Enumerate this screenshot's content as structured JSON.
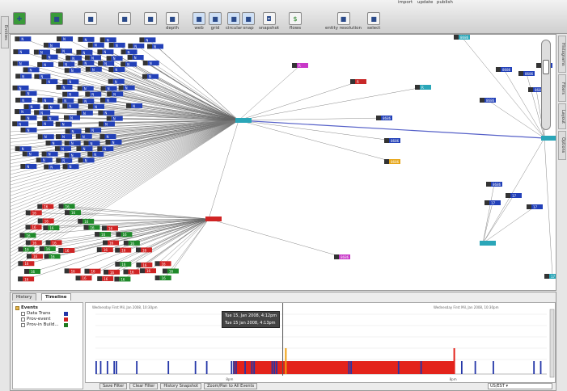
{
  "toolbar": {
    "top_buttons": [
      "import",
      "update",
      "publish"
    ],
    "tools": [
      {
        "label": "",
        "icon": "add-node-icon"
      },
      {
        "label": "",
        "icon": "pencil-icon"
      },
      {
        "label": "",
        "icon": "magnify-icon"
      },
      {
        "label": "",
        "icon": "connect-icon"
      },
      {
        "label": "",
        "icon": "group-icon"
      },
      {
        "label": "depth",
        "icon": "depth-icon"
      },
      {
        "label": "web",
        "icon": "layout-web-icon"
      },
      {
        "label": "grid",
        "icon": "layout-grid-icon"
      },
      {
        "label": "circular",
        "icon": "layout-circular-icon"
      },
      {
        "label": "snap",
        "icon": "layout-snap-icon"
      },
      {
        "label": "snapshot",
        "icon": "camera-icon"
      },
      {
        "label": "flows",
        "icon": "dollar-flows-icon"
      },
      {
        "label": "entity resolution",
        "icon": "entity-resolution-icon"
      },
      {
        "label": "select",
        "icon": "select-icon"
      }
    ]
  },
  "side_tabs": {
    "left": "Entities",
    "right": [
      "Histograms",
      "Filters",
      "Layout",
      "Options"
    ]
  },
  "graph": {
    "blue_node_label": "N",
    "red_node_label": "16",
    "green_node_label": "16",
    "hub_label": "",
    "node_labels": [
      "R",
      "R",
      "R",
      "8686",
      "8686",
      "8686",
      "8686",
      "8686",
      "8686",
      "8686",
      "8686",
      "8686",
      "8686",
      "8686",
      "17"
    ]
  },
  "bottom_tabs": [
    "History",
    "Timeline"
  ],
  "events_tree": {
    "root": "Events",
    "items": [
      {
        "label": "Data Trans",
        "color": "#2436a8"
      },
      {
        "label": "Prov-event",
        "color": "#cc2222"
      },
      {
        "label": "Prov-in Build...",
        "color": "#1f7a1f"
      }
    ]
  },
  "timeline": {
    "header_left": "Wednesday First Mil, Jan 2008, 10:30pm",
    "header_right": "Wednesday First Mil, Jan 2008, 10:30pm",
    "tooltips": [
      "Tue 15, Jan 2008, 4:12pm",
      "Tue 15 Jan 2008, 4:13pm"
    ],
    "day_labels": [
      "8pm",
      "8pm"
    ],
    "events": [
      {
        "t": 0.0,
        "color": "#2436a8"
      },
      {
        "t": 0.01,
        "color": "#2436a8"
      },
      {
        "t": 0.025,
        "color": "#2436a8"
      },
      {
        "t": 0.04,
        "color": "#2436a8"
      },
      {
        "t": 0.045,
        "color": "#2436a8"
      },
      {
        "t": 0.09,
        "color": "#2436a8"
      },
      {
        "t": 0.16,
        "color": "#2436a8"
      },
      {
        "t": 0.22,
        "color": "#2436a8"
      },
      {
        "t": 0.245,
        "color": "#2436a8"
      },
      {
        "t": 0.3,
        "color": "#2436a8"
      },
      {
        "t": 0.305,
        "color": "#2436a8"
      },
      {
        "t": 0.31,
        "color": "#2436a8"
      },
      {
        "t": 0.33,
        "color": "#2436a8"
      },
      {
        "t": 0.345,
        "color": "#2436a8"
      },
      {
        "t": 0.35,
        "color": "#2436a8"
      },
      {
        "t": 0.39,
        "color": "#2436a8"
      },
      {
        "t": 0.395,
        "color": "#2436a8"
      },
      {
        "t": 0.4,
        "color": "#2436a8"
      },
      {
        "t": 0.56,
        "color": "#2436a8"
      },
      {
        "t": 0.565,
        "color": "#2436a8"
      },
      {
        "t": 0.67,
        "color": "#2436a8"
      },
      {
        "t": 0.72,
        "color": "#2436a8"
      },
      {
        "t": 0.81,
        "color": "#2436a8"
      },
      {
        "t": 0.84,
        "color": "#2436a8"
      },
      {
        "t": 0.88,
        "color": "#2436a8"
      },
      {
        "t": 0.97,
        "color": "#2436a8"
      },
      {
        "t": 0.985,
        "color": "#2436a8"
      }
    ],
    "red_span": {
      "start": 0.305,
      "end": 0.795,
      "color": "#e3231b"
    },
    "orange_marker": {
      "t": 0.42,
      "color": "#f0a010"
    },
    "cursor_t": 0.415
  },
  "timeline_buttons": [
    "Save Filter",
    "Clear Filter",
    "History Snapshot",
    "Zoom/Pan to All Events"
  ],
  "timezone": "US/EST"
}
